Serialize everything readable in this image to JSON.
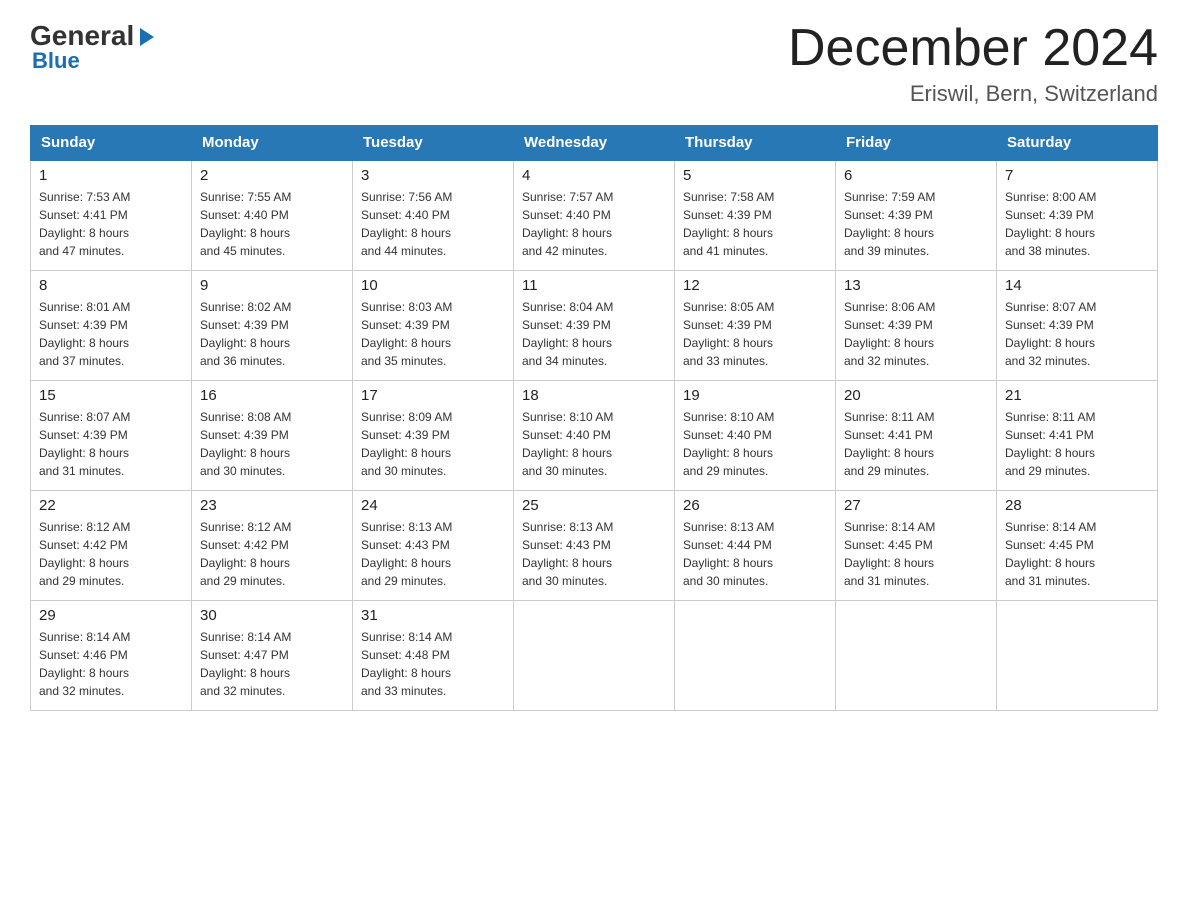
{
  "logo": {
    "general": "General",
    "blue": "Blue",
    "arrow": "▶"
  },
  "title": "December 2024",
  "subtitle": "Eriswil, Bern, Switzerland",
  "days_of_week": [
    "Sunday",
    "Monday",
    "Tuesday",
    "Wednesday",
    "Thursday",
    "Friday",
    "Saturday"
  ],
  "weeks": [
    [
      {
        "day": "1",
        "sunrise": "7:53 AM",
        "sunset": "4:41 PM",
        "daylight": "8 hours and 47 minutes."
      },
      {
        "day": "2",
        "sunrise": "7:55 AM",
        "sunset": "4:40 PM",
        "daylight": "8 hours and 45 minutes."
      },
      {
        "day": "3",
        "sunrise": "7:56 AM",
        "sunset": "4:40 PM",
        "daylight": "8 hours and 44 minutes."
      },
      {
        "day": "4",
        "sunrise": "7:57 AM",
        "sunset": "4:40 PM",
        "daylight": "8 hours and 42 minutes."
      },
      {
        "day": "5",
        "sunrise": "7:58 AM",
        "sunset": "4:39 PM",
        "daylight": "8 hours and 41 minutes."
      },
      {
        "day": "6",
        "sunrise": "7:59 AM",
        "sunset": "4:39 PM",
        "daylight": "8 hours and 39 minutes."
      },
      {
        "day": "7",
        "sunrise": "8:00 AM",
        "sunset": "4:39 PM",
        "daylight": "8 hours and 38 minutes."
      }
    ],
    [
      {
        "day": "8",
        "sunrise": "8:01 AM",
        "sunset": "4:39 PM",
        "daylight": "8 hours and 37 minutes."
      },
      {
        "day": "9",
        "sunrise": "8:02 AM",
        "sunset": "4:39 PM",
        "daylight": "8 hours and 36 minutes."
      },
      {
        "day": "10",
        "sunrise": "8:03 AM",
        "sunset": "4:39 PM",
        "daylight": "8 hours and 35 minutes."
      },
      {
        "day": "11",
        "sunrise": "8:04 AM",
        "sunset": "4:39 PM",
        "daylight": "8 hours and 34 minutes."
      },
      {
        "day": "12",
        "sunrise": "8:05 AM",
        "sunset": "4:39 PM",
        "daylight": "8 hours and 33 minutes."
      },
      {
        "day": "13",
        "sunrise": "8:06 AM",
        "sunset": "4:39 PM",
        "daylight": "8 hours and 32 minutes."
      },
      {
        "day": "14",
        "sunrise": "8:07 AM",
        "sunset": "4:39 PM",
        "daylight": "8 hours and 32 minutes."
      }
    ],
    [
      {
        "day": "15",
        "sunrise": "8:07 AM",
        "sunset": "4:39 PM",
        "daylight": "8 hours and 31 minutes."
      },
      {
        "day": "16",
        "sunrise": "8:08 AM",
        "sunset": "4:39 PM",
        "daylight": "8 hours and 30 minutes."
      },
      {
        "day": "17",
        "sunrise": "8:09 AM",
        "sunset": "4:39 PM",
        "daylight": "8 hours and 30 minutes."
      },
      {
        "day": "18",
        "sunrise": "8:10 AM",
        "sunset": "4:40 PM",
        "daylight": "8 hours and 30 minutes."
      },
      {
        "day": "19",
        "sunrise": "8:10 AM",
        "sunset": "4:40 PM",
        "daylight": "8 hours and 29 minutes."
      },
      {
        "day": "20",
        "sunrise": "8:11 AM",
        "sunset": "4:41 PM",
        "daylight": "8 hours and 29 minutes."
      },
      {
        "day": "21",
        "sunrise": "8:11 AM",
        "sunset": "4:41 PM",
        "daylight": "8 hours and 29 minutes."
      }
    ],
    [
      {
        "day": "22",
        "sunrise": "8:12 AM",
        "sunset": "4:42 PM",
        "daylight": "8 hours and 29 minutes."
      },
      {
        "day": "23",
        "sunrise": "8:12 AM",
        "sunset": "4:42 PM",
        "daylight": "8 hours and 29 minutes."
      },
      {
        "day": "24",
        "sunrise": "8:13 AM",
        "sunset": "4:43 PM",
        "daylight": "8 hours and 29 minutes."
      },
      {
        "day": "25",
        "sunrise": "8:13 AM",
        "sunset": "4:43 PM",
        "daylight": "8 hours and 30 minutes."
      },
      {
        "day": "26",
        "sunrise": "8:13 AM",
        "sunset": "4:44 PM",
        "daylight": "8 hours and 30 minutes."
      },
      {
        "day": "27",
        "sunrise": "8:14 AM",
        "sunset": "4:45 PM",
        "daylight": "8 hours and 31 minutes."
      },
      {
        "day": "28",
        "sunrise": "8:14 AM",
        "sunset": "4:45 PM",
        "daylight": "8 hours and 31 minutes."
      }
    ],
    [
      {
        "day": "29",
        "sunrise": "8:14 AM",
        "sunset": "4:46 PM",
        "daylight": "8 hours and 32 minutes."
      },
      {
        "day": "30",
        "sunrise": "8:14 AM",
        "sunset": "4:47 PM",
        "daylight": "8 hours and 32 minutes."
      },
      {
        "day": "31",
        "sunrise": "8:14 AM",
        "sunset": "4:48 PM",
        "daylight": "8 hours and 33 minutes."
      },
      null,
      null,
      null,
      null
    ]
  ],
  "labels": {
    "sunrise": "Sunrise: ",
    "sunset": "Sunset: ",
    "daylight": "Daylight: "
  }
}
